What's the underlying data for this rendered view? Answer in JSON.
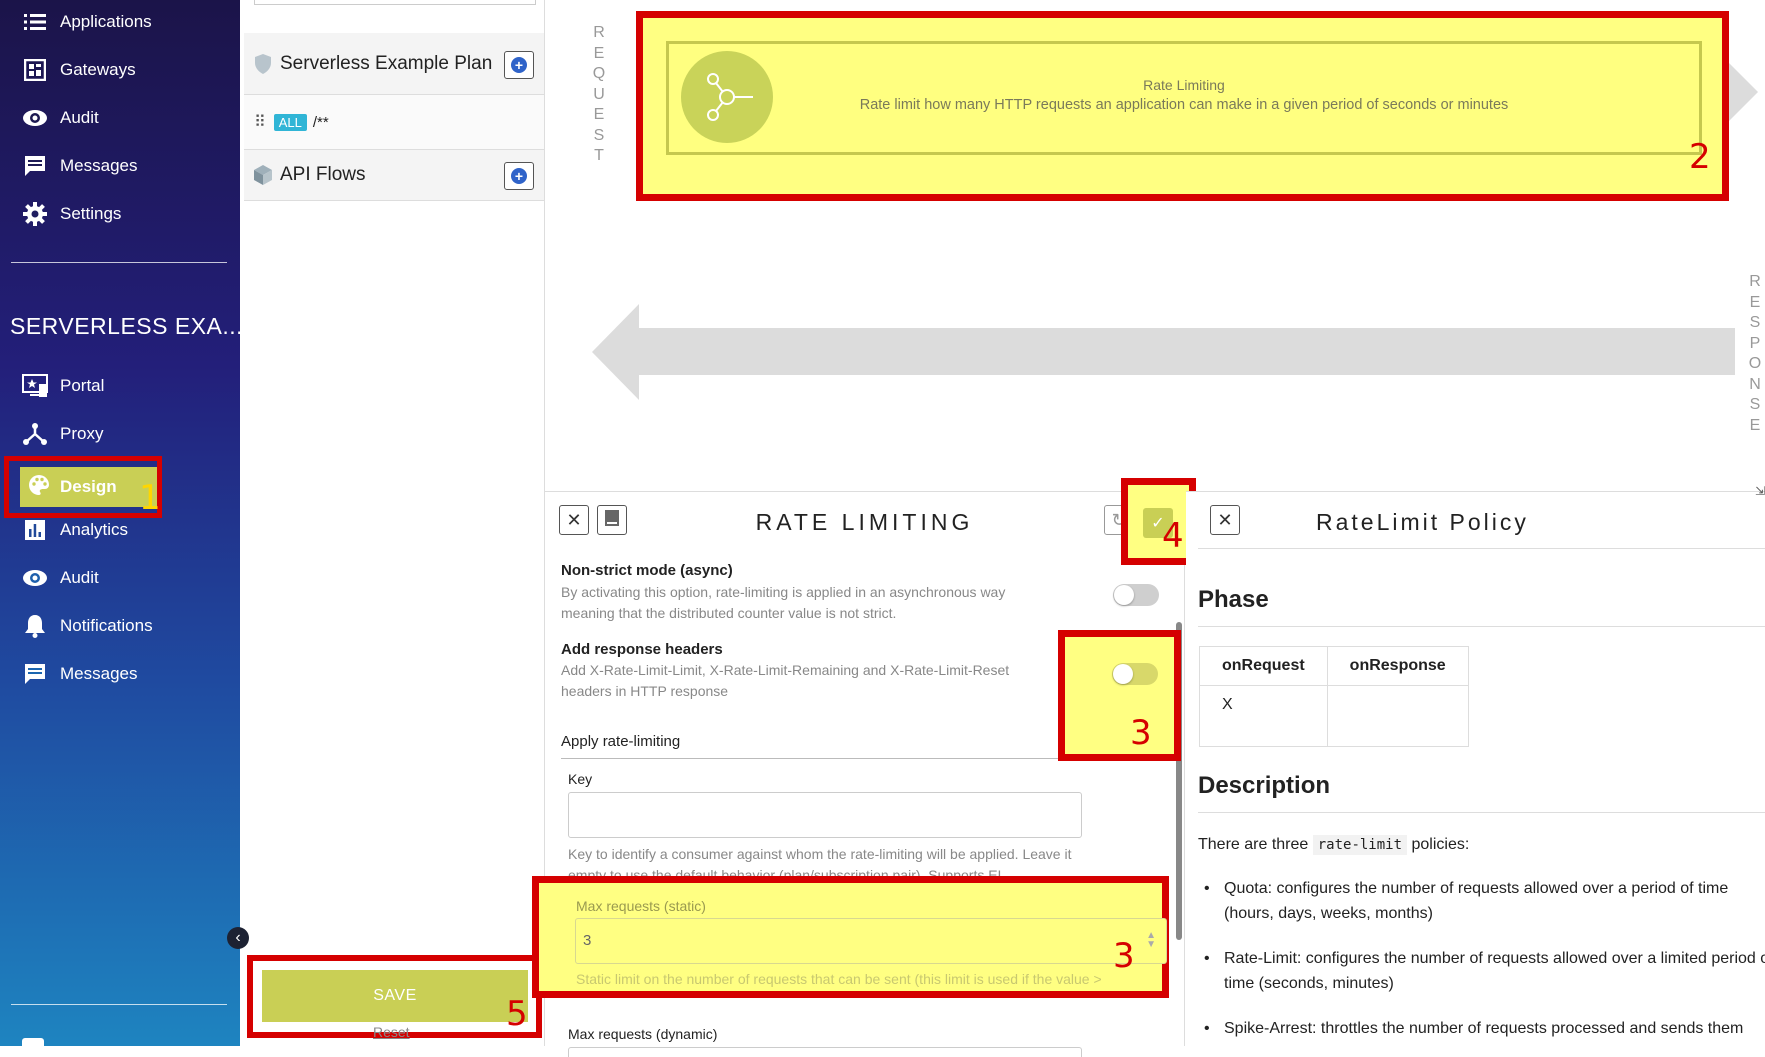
{
  "sidebar": {
    "top_items": [
      {
        "label": "Applications",
        "icon": "list-icon"
      },
      {
        "label": "Gateways",
        "icon": "gateway-icon"
      },
      {
        "label": "Audit",
        "icon": "eye-icon"
      },
      {
        "label": "Messages",
        "icon": "message-icon"
      },
      {
        "label": "Settings",
        "icon": "gear-icon"
      }
    ],
    "api_title": "SERVERLESS EXA...",
    "api_items": [
      {
        "label": "Portal",
        "icon": "portal-icon"
      },
      {
        "label": "Proxy",
        "icon": "proxy-icon"
      },
      {
        "label": "Design",
        "icon": "palette-icon",
        "active": true
      },
      {
        "label": "Analytics",
        "icon": "analytics-icon"
      },
      {
        "label": "Audit",
        "icon": "eye-icon"
      },
      {
        "label": "Notifications",
        "icon": "bell-icon"
      },
      {
        "label": "Messages",
        "icon": "message-icon"
      }
    ]
  },
  "plans": {
    "plan_name": "Serverless Example Plan",
    "flow_badge": "ALL",
    "flow_path": "/**",
    "api_flows_label": "API Flows",
    "save_label": "SAVE",
    "reset_label": "Reset"
  },
  "canvas": {
    "request_label": "REQUEST",
    "response_label": "RESPONSE",
    "policy": {
      "title": "Rate Limiting",
      "description": "Rate limit how many HTTP requests an application can make in a given period of seconds or minutes"
    }
  },
  "config": {
    "title": "RATE LIMITING",
    "non_strict_label": "Non-strict mode (async)",
    "non_strict_help": "By activating this option, rate-limiting is applied in an asynchronous way meaning that the distributed counter value is not strict.",
    "add_headers_label": "Add response headers",
    "add_headers_help": "Add X-Rate-Limit-Limit, X-Rate-Limit-Remaining and X-Rate-Limit-Reset headers in HTTP response",
    "apply_label": "Apply rate-limiting",
    "key_label": "Key",
    "key_value": "",
    "key_help": "Key to identify a consumer against whom the rate-limiting will be applied. Leave it empty to use the default behavior (plan/subscription pair). Supports EL.",
    "max_static_label": "Max requests (static)",
    "max_static_value": "3",
    "max_static_help": "Static limit on the number of requests that can be sent (this limit is used if the value >",
    "max_dynamic_label": "Max requests (dynamic)"
  },
  "docs": {
    "title": "RateLimit Policy",
    "phase_heading": "Phase",
    "phase_columns": [
      "onRequest",
      "onResponse"
    ],
    "phase_values": [
      "X",
      ""
    ],
    "description_heading": "Description",
    "intro_before": "There are three",
    "intro_code": "rate-limit",
    "intro_after": "policies:",
    "bullets": [
      {
        "line1": "Quota: configures the number of requests allowed over a period of time",
        "line2": "(hours, days, weeks, months)"
      },
      {
        "line1": "Rate-Limit: configures the number of requests allowed over a limited period of",
        "line2": "time (seconds, minutes)"
      },
      {
        "line1": "Spike-Arrest: throttles the number of requests processed and sends them",
        "line2": ""
      }
    ]
  },
  "annotations": [
    "1",
    "2",
    "3",
    "3",
    "4",
    "5"
  ],
  "colors": {
    "highlight_red": "#d50000",
    "highlight_yellow": "#ffff82",
    "accent_green": "#c9cf55",
    "badge_blue": "#30b5d6"
  }
}
